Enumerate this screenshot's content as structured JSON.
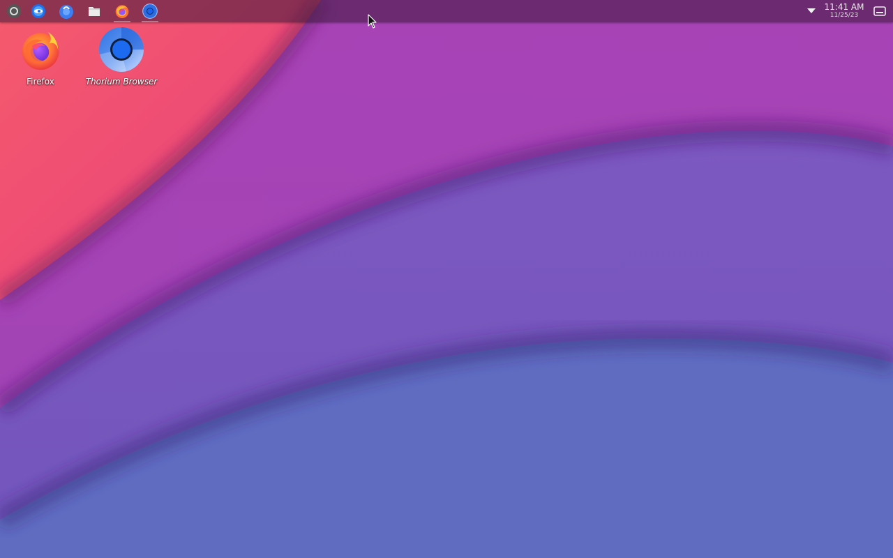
{
  "wallpaper": {
    "colors": {
      "band_red": "#ef4374",
      "band_magenta": "#aa45b8",
      "band_violet": "#7a58be",
      "band_blue": "#5f6cc0"
    }
  },
  "panel": {
    "launchers": [
      {
        "name": "App Menu",
        "icon": "app-menu-icon",
        "color": "#9a9a9a"
      },
      {
        "name": "Browser",
        "icon": "browser-icon",
        "color": "#2f7df0"
      },
      {
        "name": "Store",
        "icon": "store-icon",
        "color": "#3b7cf0"
      },
      {
        "name": "Files",
        "icon": "folder-icon",
        "color": "#e8e8e8"
      },
      {
        "name": "Firefox",
        "icon": "firefox-icon",
        "color": "#ff7139"
      },
      {
        "name": "Thorium Browser",
        "icon": "thorium-icon",
        "color": "#4a8ef0"
      }
    ],
    "tray_arrow_icon": "chevron-down-icon",
    "clock": {
      "time": "11:41 AM",
      "date": "11/25/23"
    },
    "show_desktop_icon": "show-desktop-icon"
  },
  "desktop_icons": [
    {
      "label": "Firefox",
      "icon": "firefox-icon"
    },
    {
      "label": "Thorium Browser",
      "icon": "thorium-icon"
    }
  ]
}
